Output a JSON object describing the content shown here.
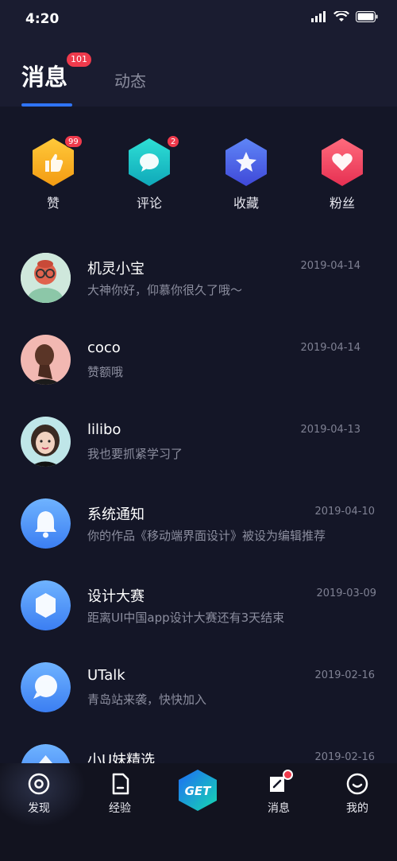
{
  "status_bar": {
    "time": "4:20"
  },
  "header": {
    "tabs": [
      {
        "label": "消息",
        "badge": "101",
        "active": true
      },
      {
        "label": "动态",
        "active": false
      }
    ]
  },
  "quick_actions": [
    {
      "label": "赞",
      "badge": "99",
      "icon": "thumbs-up-icon",
      "color": "#f7b21f"
    },
    {
      "label": "评论",
      "badge": "2",
      "icon": "comment-icon",
      "color": "#18c3c9"
    },
    {
      "label": "收藏",
      "badge": "",
      "icon": "star-icon",
      "color": "#4a64e8"
    },
    {
      "label": "粉丝",
      "badge": "",
      "icon": "heart-icon",
      "color": "#f0475e"
    }
  ],
  "messages": [
    {
      "title": "机灵小宝",
      "subtitle": "大神你好，仰慕你很久了哦～",
      "date": "2019-04-14",
      "avatar": "avatar-cartoon"
    },
    {
      "title": "coco",
      "subtitle": "赞额哦",
      "date": "2019-04-14",
      "avatar": "avatar-woman"
    },
    {
      "title": "lilibo",
      "subtitle": "我也要抓紧学习了",
      "date": "2019-04-13",
      "avatar": "avatar-girl"
    },
    {
      "title": "系统通知",
      "subtitle": "你的作品《移动端界面设计》被设为编辑推荐",
      "date": "2019-04-10",
      "avatar": "bell-icon"
    },
    {
      "title": "设计大赛",
      "subtitle": "距离UI中国app设计大赛还有3天结束",
      "date": "2019-03-09",
      "avatar": "hexagon-icon"
    },
    {
      "title": "UTalk",
      "subtitle": "青岛站来袭，快快加入",
      "date": "2019-02-16",
      "avatar": "chat-bubble-icon"
    },
    {
      "title": "小U妹精选",
      "subtitle": "",
      "date": "2019-02-16",
      "avatar": "upload-icon"
    }
  ],
  "tabbar": {
    "items": [
      {
        "label": "发现",
        "icon": "discover-icon"
      },
      {
        "label": "经验",
        "icon": "document-icon"
      },
      {
        "label": "GET",
        "icon": "get-hexagon-icon"
      },
      {
        "label": "消息",
        "icon": "message-edit-icon",
        "dot": true
      },
      {
        "label": "我的",
        "icon": "profile-smile-icon"
      }
    ]
  }
}
